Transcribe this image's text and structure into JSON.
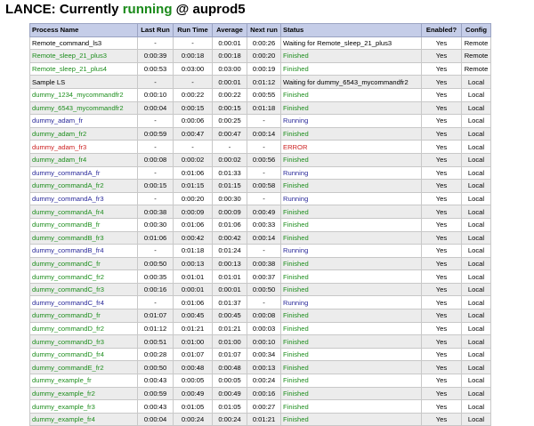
{
  "title": {
    "prefix": "LANCE: Currently ",
    "state": "running",
    "suffix": " @ auprod5"
  },
  "columns": [
    "Process Name",
    "Last Run",
    "Run Time",
    "Average",
    "Next run",
    "Status",
    "Enabled?",
    "Config"
  ],
  "rows": [
    {
      "name": "Remote_command_ls3",
      "last": "-",
      "runtime": "-",
      "average": "0:00:01",
      "next": "0:00:26",
      "status": "Waiting for Remote_sleep_21_plus3",
      "enabled": "Yes",
      "config": "Remote",
      "kind": "plain"
    },
    {
      "name": "Remote_sleep_21_plus3",
      "last": "0:00:39",
      "runtime": "0:00:18",
      "average": "0:00:18",
      "next": "0:00:20",
      "status": "Finished",
      "enabled": "Yes",
      "config": "Remote",
      "kind": "fin"
    },
    {
      "name": "Remote_sleep_21_plus4",
      "last": "0:00:53",
      "runtime": "0:03:00",
      "average": "0:03:00",
      "next": "0:00:19",
      "status": "Finished",
      "enabled": "Yes",
      "config": "Remote",
      "kind": "fin"
    },
    {
      "name": "Sample LS",
      "last": "-",
      "runtime": "-",
      "average": "0:00:01",
      "next": "0:01:12",
      "status": "Waiting for dummy_6543_mycommandfr2",
      "enabled": "Yes",
      "config": "Local",
      "kind": "plain"
    },
    {
      "name": "dummy_1234_mycommandfr2",
      "last": "0:00:10",
      "runtime": "0:00:22",
      "average": "0:00:22",
      "next": "0:00:55",
      "status": "Finished",
      "enabled": "Yes",
      "config": "Local",
      "kind": "fin"
    },
    {
      "name": "dummy_6543_mycommandfr2",
      "last": "0:00:04",
      "runtime": "0:00:15",
      "average": "0:00:15",
      "next": "0:01:18",
      "status": "Finished",
      "enabled": "Yes",
      "config": "Local",
      "kind": "fin"
    },
    {
      "name": "dummy_adam_fr",
      "last": "-",
      "runtime": "0:00:06",
      "average": "0:00:25",
      "next": "-",
      "status": "Running",
      "enabled": "Yes",
      "config": "Local",
      "kind": "run"
    },
    {
      "name": "dummy_adam_fr2",
      "last": "0:00:59",
      "runtime": "0:00:47",
      "average": "0:00:47",
      "next": "0:00:14",
      "status": "Finished",
      "enabled": "Yes",
      "config": "Local",
      "kind": "fin"
    },
    {
      "name": "dummy_adam_fr3",
      "last": "-",
      "runtime": "-",
      "average": "-",
      "next": "-",
      "status": "ERROR",
      "enabled": "Yes",
      "config": "Local",
      "kind": "err"
    },
    {
      "name": "dummy_adam_fr4",
      "last": "0:00:08",
      "runtime": "0:00:02",
      "average": "0:00:02",
      "next": "0:00:56",
      "status": "Finished",
      "enabled": "Yes",
      "config": "Local",
      "kind": "fin"
    },
    {
      "name": "dummy_commandA_fr",
      "last": "-",
      "runtime": "0:01:06",
      "average": "0:01:33",
      "next": "-",
      "status": "Running",
      "enabled": "Yes",
      "config": "Local",
      "kind": "run"
    },
    {
      "name": "dummy_commandA_fr2",
      "last": "0:00:15",
      "runtime": "0:01:15",
      "average": "0:01:15",
      "next": "0:00:58",
      "status": "Finished",
      "enabled": "Yes",
      "config": "Local",
      "kind": "fin"
    },
    {
      "name": "dummy_commandA_fr3",
      "last": "-",
      "runtime": "0:00:20",
      "average": "0:00:30",
      "next": "-",
      "status": "Running",
      "enabled": "Yes",
      "config": "Local",
      "kind": "run"
    },
    {
      "name": "dummy_commandA_fr4",
      "last": "0:00:38",
      "runtime": "0:00:09",
      "average": "0:00:09",
      "next": "0:00:49",
      "status": "Finished",
      "enabled": "Yes",
      "config": "Local",
      "kind": "fin"
    },
    {
      "name": "dummy_commandB_fr",
      "last": "0:00:30",
      "runtime": "0:01:06",
      "average": "0:01:06",
      "next": "0:00:33",
      "status": "Finished",
      "enabled": "Yes",
      "config": "Local",
      "kind": "fin"
    },
    {
      "name": "dummy_commandB_fr3",
      "last": "0:01:06",
      "runtime": "0:00:42",
      "average": "0:00:42",
      "next": "0:00:14",
      "status": "Finished",
      "enabled": "Yes",
      "config": "Local",
      "kind": "fin"
    },
    {
      "name": "dummy_commandB_fr4",
      "last": "-",
      "runtime": "0:01:18",
      "average": "0:01:24",
      "next": "-",
      "status": "Running",
      "enabled": "Yes",
      "config": "Local",
      "kind": "run"
    },
    {
      "name": "dummy_commandC_fr",
      "last": "0:00:50",
      "runtime": "0:00:13",
      "average": "0:00:13",
      "next": "0:00:38",
      "status": "Finished",
      "enabled": "Yes",
      "config": "Local",
      "kind": "fin"
    },
    {
      "name": "dummy_commandC_fr2",
      "last": "0:00:35",
      "runtime": "0:01:01",
      "average": "0:01:01",
      "next": "0:00:37",
      "status": "Finished",
      "enabled": "Yes",
      "config": "Local",
      "kind": "fin"
    },
    {
      "name": "dummy_commandC_fr3",
      "last": "0:00:16",
      "runtime": "0:00:01",
      "average": "0:00:01",
      "next": "0:00:50",
      "status": "Finished",
      "enabled": "Yes",
      "config": "Local",
      "kind": "fin"
    },
    {
      "name": "dummy_commandC_fr4",
      "last": "-",
      "runtime": "0:01:06",
      "average": "0:01:37",
      "next": "-",
      "status": "Running",
      "enabled": "Yes",
      "config": "Local",
      "kind": "run"
    },
    {
      "name": "dummy_commandD_fr",
      "last": "0:01:07",
      "runtime": "0:00:45",
      "average": "0:00:45",
      "next": "0:00:08",
      "status": "Finished",
      "enabled": "Yes",
      "config": "Local",
      "kind": "fin"
    },
    {
      "name": "dummy_commandD_fr2",
      "last": "0:01:12",
      "runtime": "0:01:21",
      "average": "0:01:21",
      "next": "0:00:03",
      "status": "Finished",
      "enabled": "Yes",
      "config": "Local",
      "kind": "fin"
    },
    {
      "name": "dummy_commandD_fr3",
      "last": "0:00:51",
      "runtime": "0:01:00",
      "average": "0:01:00",
      "next": "0:00:10",
      "status": "Finished",
      "enabled": "Yes",
      "config": "Local",
      "kind": "fin"
    },
    {
      "name": "dummy_commandD_fr4",
      "last": "0:00:28",
      "runtime": "0:01:07",
      "average": "0:01:07",
      "next": "0:00:34",
      "status": "Finished",
      "enabled": "Yes",
      "config": "Local",
      "kind": "fin"
    },
    {
      "name": "dummy_commandE_fr2",
      "last": "0:00:50",
      "runtime": "0:00:48",
      "average": "0:00:48",
      "next": "0:00:13",
      "status": "Finished",
      "enabled": "Yes",
      "config": "Local",
      "kind": "fin"
    },
    {
      "name": "dummy_example_fr",
      "last": "0:00:43",
      "runtime": "0:00:05",
      "average": "0:00:05",
      "next": "0:00:24",
      "status": "Finished",
      "enabled": "Yes",
      "config": "Local",
      "kind": "fin"
    },
    {
      "name": "dummy_example_fr2",
      "last": "0:00:59",
      "runtime": "0:00:49",
      "average": "0:00:49",
      "next": "0:00:16",
      "status": "Finished",
      "enabled": "Yes",
      "config": "Local",
      "kind": "fin"
    },
    {
      "name": "dummy_example_fr3",
      "last": "0:00:43",
      "runtime": "0:01:05",
      "average": "0:01:05",
      "next": "0:00:27",
      "status": "Finished",
      "enabled": "Yes",
      "config": "Local",
      "kind": "fin"
    },
    {
      "name": "dummy_example_fr4",
      "last": "0:00:04",
      "runtime": "0:00:24",
      "average": "0:00:24",
      "next": "0:01:21",
      "status": "Finished",
      "enabled": "Yes",
      "config": "Local",
      "kind": "fin"
    }
  ]
}
